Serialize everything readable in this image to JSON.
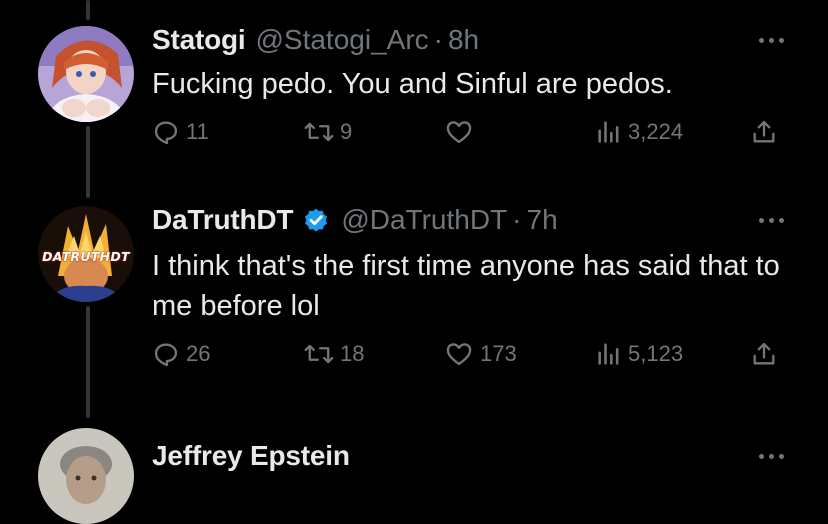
{
  "tweets": [
    {
      "name": "Statogi",
      "handle": "@Statogi_Arc",
      "time": "8h",
      "verified": false,
      "text": "Fucking pedo. You and Sinful are pedos.",
      "replies": "11",
      "reposts": "9",
      "likes": "",
      "views": "3,224"
    },
    {
      "name": "DaTruthDT",
      "handle": "@DaTruthDT",
      "time": "7h",
      "verified": true,
      "text": "I think that's the first time anyone has said that to me before lol",
      "replies": "26",
      "reposts": "18",
      "likes": "173",
      "views": "5,123",
      "avatar_text": "DATRUTHDT"
    },
    {
      "name": "Jeffrey Epstein"
    }
  ],
  "separator": "·",
  "colors": {
    "background": "#000000",
    "text": "#e7e9ea",
    "muted": "#71767b",
    "verified": "#1d9bf0",
    "thread_line": "#333639"
  },
  "icons": [
    "reply-icon",
    "repost-icon",
    "like-icon",
    "views-icon",
    "share-icon",
    "more-icon",
    "verified-badge-icon"
  ]
}
